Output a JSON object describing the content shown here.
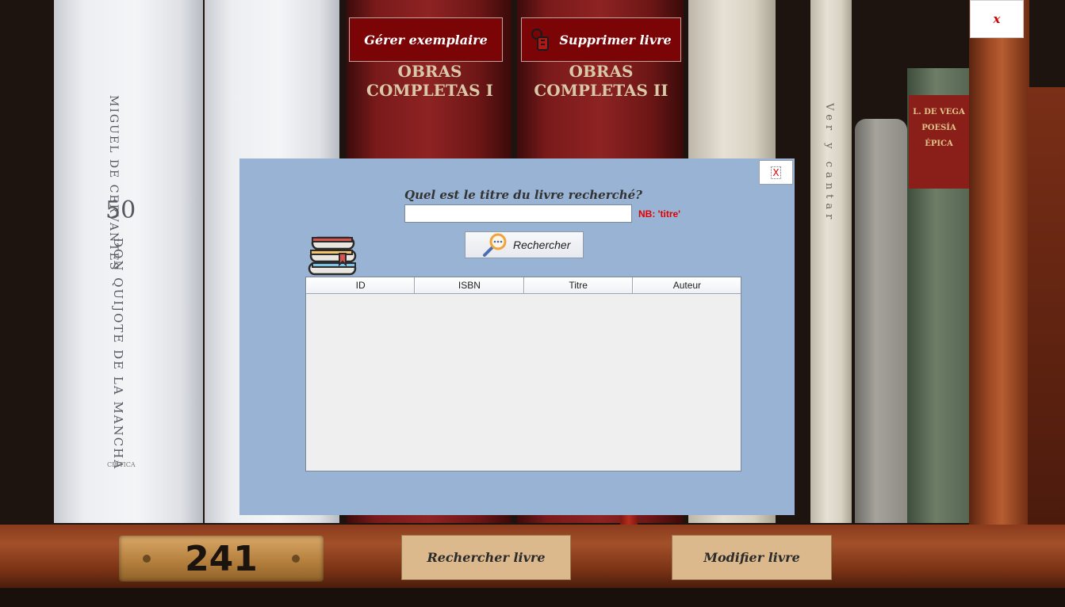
{
  "top_buttons": {
    "manage_copies": "Gérer exemplaire",
    "delete_book": "Supprimer livre",
    "close": "x"
  },
  "bottom_buttons": {
    "search_book": "Rechercher livre",
    "edit_book": "Modifier livre"
  },
  "background": {
    "shelf_number": "241",
    "spine_author": "MIGUEL DE CERVANTES",
    "spine_number": "50",
    "spine_title": "DON QUIJOTE DE LA MANCHA",
    "spine_publisher": "CRÍTICA",
    "red_book_1": "OBRAS COMPLETAS I",
    "red_book_2": "OBRAS COMPLETAS II",
    "cream_book": "Ver y cantar",
    "green_book": "L. DE VEGA POESÍA ÉPICA"
  },
  "dialog": {
    "close": "X",
    "question": "Quel est le titre du livre recherché?",
    "title_input_value": "",
    "nb_hint": "NB: 'titre'",
    "search_button": "Rechercher",
    "table": {
      "columns": [
        "ID",
        "ISBN",
        "Titre",
        "Auteur"
      ],
      "rows": []
    }
  },
  "colors": {
    "top_button_bg": "#7a0406",
    "bottom_button_bg": "#dcb98c",
    "dialog_bg": "#98b3d3",
    "hint_red": "#e00000"
  }
}
